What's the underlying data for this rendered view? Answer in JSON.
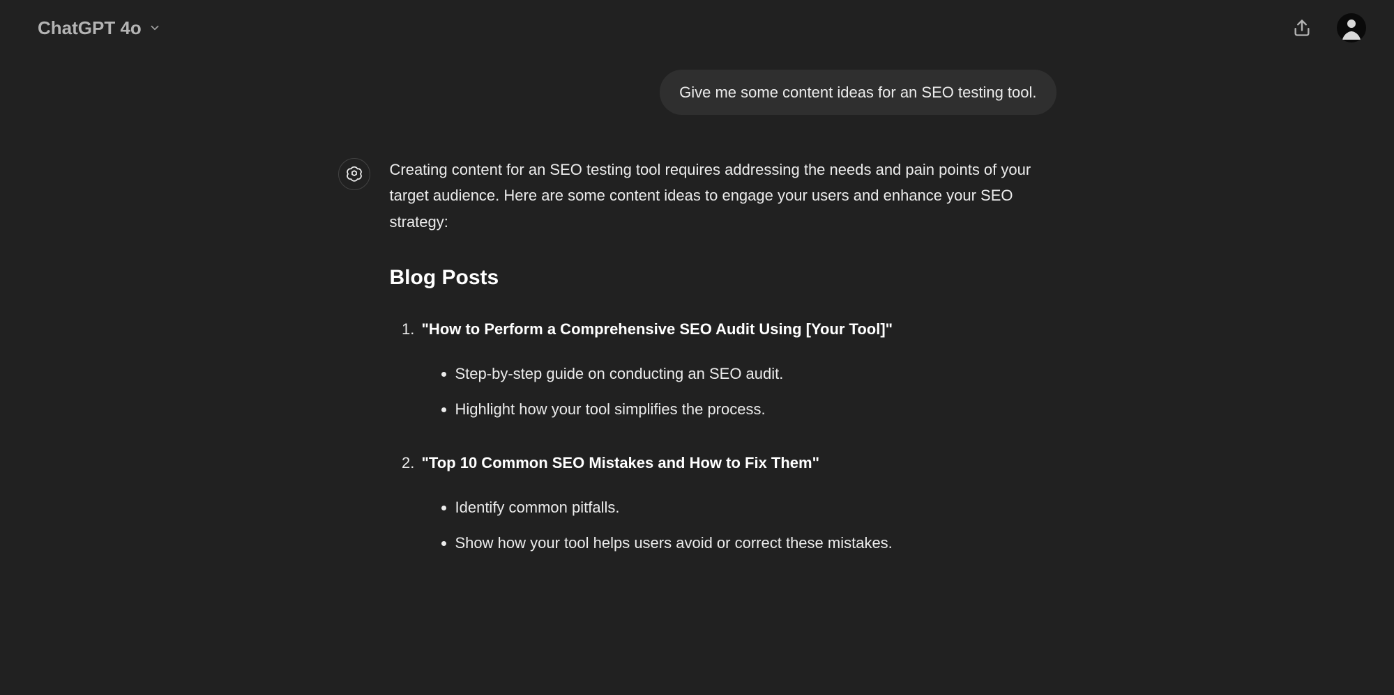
{
  "header": {
    "model_label": "ChatGPT 4o"
  },
  "conversation": {
    "user_message": "Give me some content ideas for an SEO testing tool.",
    "assistant": {
      "intro": "Creating content for an SEO testing tool requires addressing the needs and pain points of your target audience. Here are some content ideas to engage your users and enhance your SEO strategy:",
      "section_title": "Blog Posts",
      "posts": [
        {
          "title": "\"How to Perform a Comprehensive SEO Audit Using [Your Tool]\"",
          "bullets": [
            "Step-by-step guide on conducting an SEO audit.",
            "Highlight how your tool simplifies the process."
          ]
        },
        {
          "title": "\"Top 10 Common SEO Mistakes and How to Fix Them\"",
          "bullets": [
            "Identify common pitfalls.",
            "Show how your tool helps users avoid or correct these mistakes."
          ]
        }
      ]
    }
  }
}
